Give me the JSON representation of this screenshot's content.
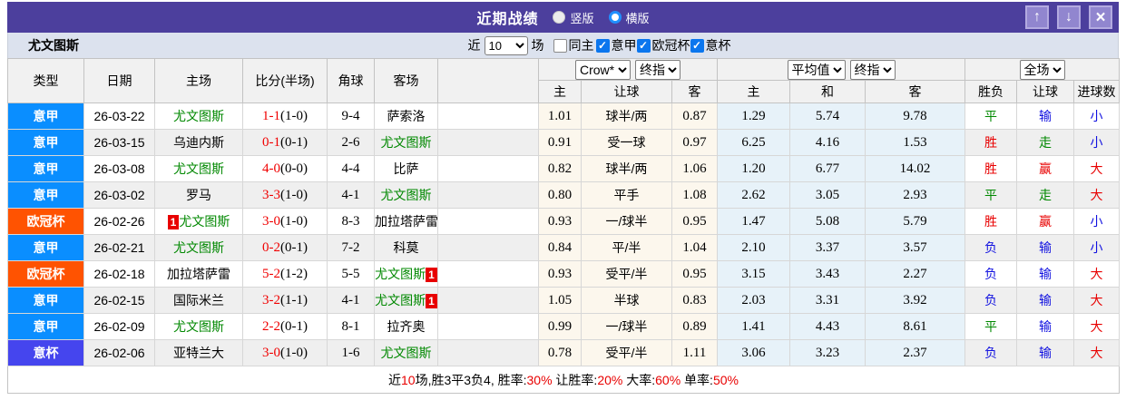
{
  "colors": {
    "red": "#e80000",
    "green": "#008800",
    "blue": "#1212e0",
    "titlebar": "#4c3f9d",
    "accent_blue": "#0b76ee"
  },
  "type_colors": {
    "意甲": "#0a8eff",
    "欧冠杯": "#ff5301",
    "意杯": "#4545ee"
  },
  "titlebar": {
    "title": "近期战绩",
    "radio_vertical": "竖版",
    "radio_horizontal": "横版",
    "radio_selected": "横版",
    "icons": {
      "up": "↑",
      "down": "↓",
      "close": "×"
    }
  },
  "toolbar": {
    "team": "尤文图斯",
    "near_label": "近",
    "count_value": "10",
    "matches_label": "场",
    "filters": [
      {
        "label": "同主",
        "checked": false
      },
      {
        "label": "意甲",
        "checked": true
      },
      {
        "label": "欧冠杯",
        "checked": true
      },
      {
        "label": "意杯",
        "checked": true
      }
    ]
  },
  "table": {
    "selects": {
      "crow": "Crow*",
      "crow_ref": "终指",
      "avg": "平均值",
      "avg_ref": "终指",
      "full": "全场"
    },
    "col_headers_left": [
      "类型",
      "日期",
      "主场",
      "比分(半场)",
      "角球",
      "客场",
      ""
    ],
    "col_headers_sub": [
      "主",
      "让球",
      "客",
      "主",
      "和",
      "客",
      "胜负",
      "让球",
      "进球数"
    ],
    "rows": [
      {
        "type": "意甲",
        "date": "26-03-22",
        "home": {
          "name": "尤文图斯",
          "green": true
        },
        "score": "1-1",
        "half": "(1-0)",
        "corners": "9-4",
        "away": {
          "name": "萨索洛",
          "green": false
        },
        "crow": [
          "1.01",
          "球半/两",
          "0.87"
        ],
        "avg": [
          "1.29",
          "5.74",
          "9.78"
        ],
        "full": [
          [
            "平",
            "green"
          ],
          [
            "输",
            "blue"
          ],
          [
            "小",
            "blue"
          ]
        ]
      },
      {
        "type": "意甲",
        "date": "26-03-15",
        "home": {
          "name": "乌迪内斯",
          "green": false
        },
        "score": "0-1",
        "half": "(0-1)",
        "corners": "2-6",
        "away": {
          "name": "尤文图斯",
          "green": true
        },
        "crow": [
          "0.91",
          "受一球",
          "0.97"
        ],
        "avg": [
          "6.25",
          "4.16",
          "1.53"
        ],
        "full": [
          [
            "胜",
            "red"
          ],
          [
            "走",
            "green"
          ],
          [
            "小",
            "blue"
          ]
        ]
      },
      {
        "type": "意甲",
        "date": "26-03-08",
        "home": {
          "name": "尤文图斯",
          "green": true
        },
        "score": "4-0",
        "half": "(0-0)",
        "corners": "4-4",
        "away": {
          "name": "比萨",
          "green": false
        },
        "crow": [
          "0.82",
          "球半/两",
          "1.06"
        ],
        "avg": [
          "1.20",
          "6.77",
          "14.02"
        ],
        "full": [
          [
            "胜",
            "red"
          ],
          [
            "赢",
            "red"
          ],
          [
            "大",
            "red"
          ]
        ]
      },
      {
        "type": "意甲",
        "date": "26-03-02",
        "home": {
          "name": "罗马",
          "green": false
        },
        "score": "3-3",
        "half": "(1-0)",
        "corners": "4-1",
        "away": {
          "name": "尤文图斯",
          "green": true
        },
        "crow": [
          "0.80",
          "平手",
          "1.08"
        ],
        "avg": [
          "2.62",
          "3.05",
          "2.93"
        ],
        "full": [
          [
            "平",
            "green"
          ],
          [
            "走",
            "green"
          ],
          [
            "大",
            "red"
          ]
        ]
      },
      {
        "type": "欧冠杯",
        "date": "26-02-26",
        "home": {
          "name": "尤文图斯",
          "green": true,
          "badge": "1",
          "badge_pos": "before"
        },
        "score": "3-0",
        "half": "(1-0)",
        "corners": "8-3",
        "away": {
          "name": "加拉塔萨雷",
          "green": false
        },
        "crow": [
          "0.93",
          "一/球半",
          "0.95"
        ],
        "avg": [
          "1.47",
          "5.08",
          "5.79"
        ],
        "full": [
          [
            "胜",
            "red"
          ],
          [
            "赢",
            "red"
          ],
          [
            "小",
            "blue"
          ]
        ]
      },
      {
        "type": "意甲",
        "date": "26-02-21",
        "home": {
          "name": "尤文图斯",
          "green": true
        },
        "score": "0-2",
        "half": "(0-1)",
        "corners": "7-2",
        "away": {
          "name": "科莫",
          "green": false
        },
        "crow": [
          "0.84",
          "平/半",
          "1.04"
        ],
        "avg": [
          "2.10",
          "3.37",
          "3.57"
        ],
        "full": [
          [
            "负",
            "blue"
          ],
          [
            "输",
            "blue"
          ],
          [
            "小",
            "blue"
          ]
        ]
      },
      {
        "type": "欧冠杯",
        "date": "26-02-18",
        "home": {
          "name": "加拉塔萨雷",
          "green": false
        },
        "score": "5-2",
        "half": "(1-2)",
        "corners": "5-5",
        "away": {
          "name": "尤文图斯",
          "green": true,
          "badge": "1",
          "badge_pos": "after"
        },
        "crow": [
          "0.93",
          "受平/半",
          "0.95"
        ],
        "avg": [
          "3.15",
          "3.43",
          "2.27"
        ],
        "full": [
          [
            "负",
            "blue"
          ],
          [
            "输",
            "blue"
          ],
          [
            "大",
            "red"
          ]
        ]
      },
      {
        "type": "意甲",
        "date": "26-02-15",
        "home": {
          "name": "国际米兰",
          "green": false
        },
        "score": "3-2",
        "half": "(1-1)",
        "corners": "4-1",
        "away": {
          "name": "尤文图斯",
          "green": true,
          "badge": "1",
          "badge_pos": "after"
        },
        "crow": [
          "1.05",
          "半球",
          "0.83"
        ],
        "avg": [
          "2.03",
          "3.31",
          "3.92"
        ],
        "full": [
          [
            "负",
            "blue"
          ],
          [
            "输",
            "blue"
          ],
          [
            "大",
            "red"
          ]
        ]
      },
      {
        "type": "意甲",
        "date": "26-02-09",
        "home": {
          "name": "尤文图斯",
          "green": true
        },
        "score": "2-2",
        "half": "(0-1)",
        "corners": "8-1",
        "away": {
          "name": "拉齐奥",
          "green": false
        },
        "crow": [
          "0.99",
          "一/球半",
          "0.89"
        ],
        "avg": [
          "1.41",
          "4.43",
          "8.61"
        ],
        "full": [
          [
            "平",
            "green"
          ],
          [
            "输",
            "blue"
          ],
          [
            "大",
            "red"
          ]
        ]
      },
      {
        "type": "意杯",
        "date": "26-02-06",
        "home": {
          "name": "亚特兰大",
          "green": false
        },
        "score": "3-0",
        "half": "(1-0)",
        "corners": "1-6",
        "away": {
          "name": "尤文图斯",
          "green": true
        },
        "crow": [
          "0.78",
          "受平/半",
          "1.11"
        ],
        "avg": [
          "3.06",
          "3.23",
          "2.37"
        ],
        "full": [
          [
            "负",
            "blue"
          ],
          [
            "输",
            "blue"
          ],
          [
            "大",
            "red"
          ]
        ]
      }
    ]
  },
  "footer": {
    "segments": [
      [
        "近",
        false
      ],
      [
        "10",
        true
      ],
      [
        "场,胜3平3负4, 胜率:",
        false
      ],
      [
        "30%",
        true
      ],
      [
        " 让胜率:",
        false
      ],
      [
        "20%",
        true
      ],
      [
        " 大率:",
        false
      ],
      [
        "60%",
        true
      ],
      [
        " 单率:",
        false
      ],
      [
        "50%",
        true
      ]
    ]
  }
}
